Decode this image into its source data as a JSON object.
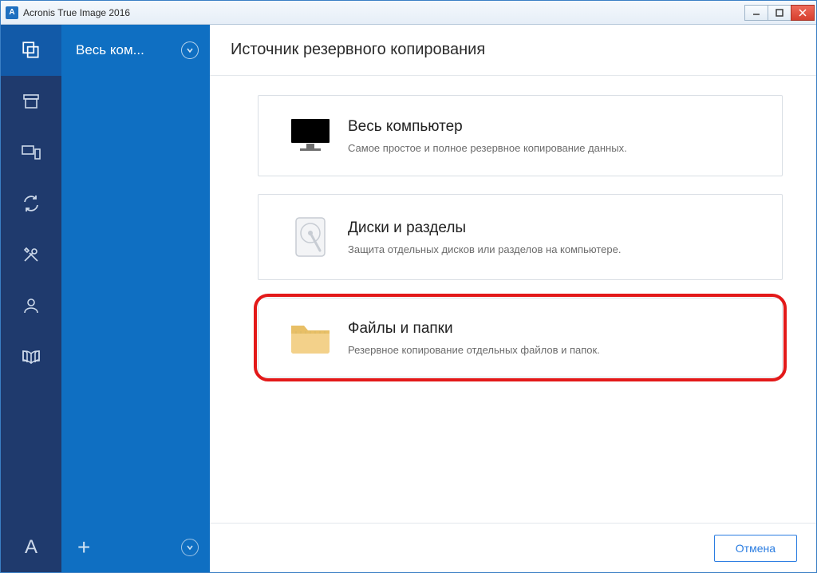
{
  "window": {
    "title": "Acronis True Image 2016",
    "app_icon_letter": "A"
  },
  "side": {
    "header_label": "Весь ком..."
  },
  "main": {
    "heading": "Источник резервного копирования",
    "options": [
      {
        "title": "Весь компьютер",
        "desc": "Самое простое и полное резервное копирование данных."
      },
      {
        "title": "Диски и разделы",
        "desc": "Защита отдельных дисков или разделов на компьютере."
      },
      {
        "title": "Файлы и папки",
        "desc": "Резервное копирование отдельных файлов и папок."
      }
    ],
    "cancel_label": "Отмена"
  }
}
